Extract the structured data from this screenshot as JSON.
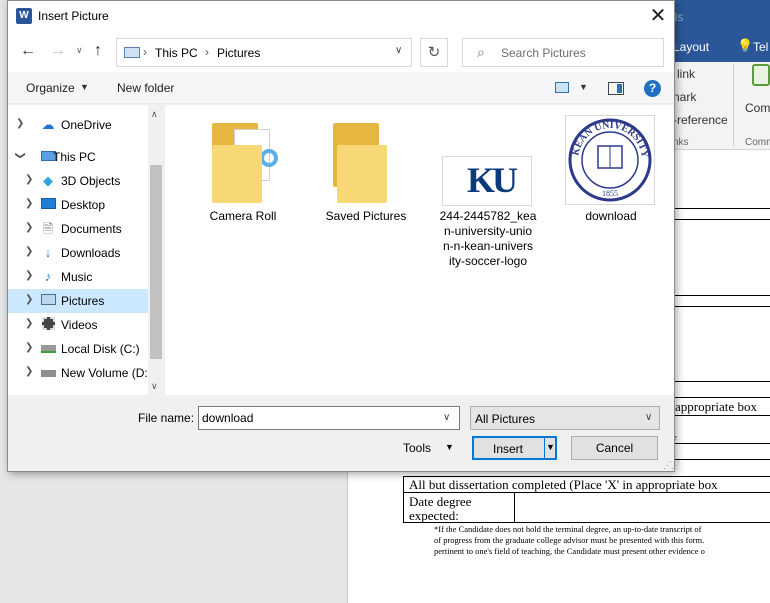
{
  "background": {
    "ribbon": {
      "tools_label": "ols",
      "layout_tab": "Layout",
      "tell_label": "Tel",
      "items": [
        "link",
        "nark",
        "-reference",
        "nks"
      ],
      "comment_label": "Com",
      "comment_group": "Comm"
    },
    "document": {
      "appropriate_box_text": "appropriate box",
      "small_e": "e",
      "abd_text": "All but dissertation completed (Place 'X' in appropriate box",
      "date_label_1": "Date degree",
      "date_label_2": "expected:",
      "footnote_1": "*If the Candidate does not hold the terminal degree, an up-to-date transcript of",
      "footnote_2": "of progress from the graduate college advisor must be presented with this form.",
      "footnote_3": "pertinent to one's field of teaching, the Candidate must present other evidence o"
    }
  },
  "dialog": {
    "title": "Insert Picture",
    "app_icon_letter": "W",
    "close_symbol": "✕",
    "breadcrumb": [
      "This PC",
      "Pictures"
    ],
    "search_placeholder": "Search Pictures",
    "toolbar": {
      "organize_label": "Organize",
      "new_folder_label": "New folder",
      "help_symbol": "?"
    },
    "nav_items": [
      {
        "label": "OneDrive",
        "icon": "cloud-icon",
        "selected": false
      },
      {
        "label": "This PC",
        "icon": "computer-icon",
        "selected": false
      },
      {
        "label": "3D Objects",
        "icon": "cube-icon",
        "selected": false
      },
      {
        "label": "Desktop",
        "icon": "desktop-icon",
        "selected": false
      },
      {
        "label": "Documents",
        "icon": "documents-icon",
        "selected": false
      },
      {
        "label": "Downloads",
        "icon": "download-arrow-icon",
        "selected": false
      },
      {
        "label": "Music",
        "icon": "music-note-icon",
        "selected": false
      },
      {
        "label": "Pictures",
        "icon": "pictures-icon",
        "selected": true
      },
      {
        "label": "Videos",
        "icon": "film-icon",
        "selected": false
      },
      {
        "label": "Local Disk (C:)",
        "icon": "drive-icon",
        "selected": false
      },
      {
        "label": "New Volume (D:",
        "icon": "drive-icon",
        "selected": false
      }
    ],
    "files": [
      {
        "label": "Camera Roll",
        "kind": "folder"
      },
      {
        "label": "Saved Pictures",
        "kind": "folder"
      },
      {
        "label": "244-2445782_kean-university-union-n-kean-university-soccer-logo",
        "lines": [
          "244-2445782_kea",
          "n-university-unio",
          "n-n-kean-univers",
          "ity-soccer-logo"
        ],
        "kind": "image",
        "logo_text": "KU"
      },
      {
        "label": "download",
        "kind": "image",
        "seal_text": "KEAN UNIVERSITY",
        "seal_year": "1855"
      }
    ],
    "filename_label": "File name:",
    "filename_value": "download",
    "filetype_value": "All Pictures",
    "tools_label": "Tools",
    "insert_label": "Insert",
    "cancel_label": "Cancel"
  }
}
